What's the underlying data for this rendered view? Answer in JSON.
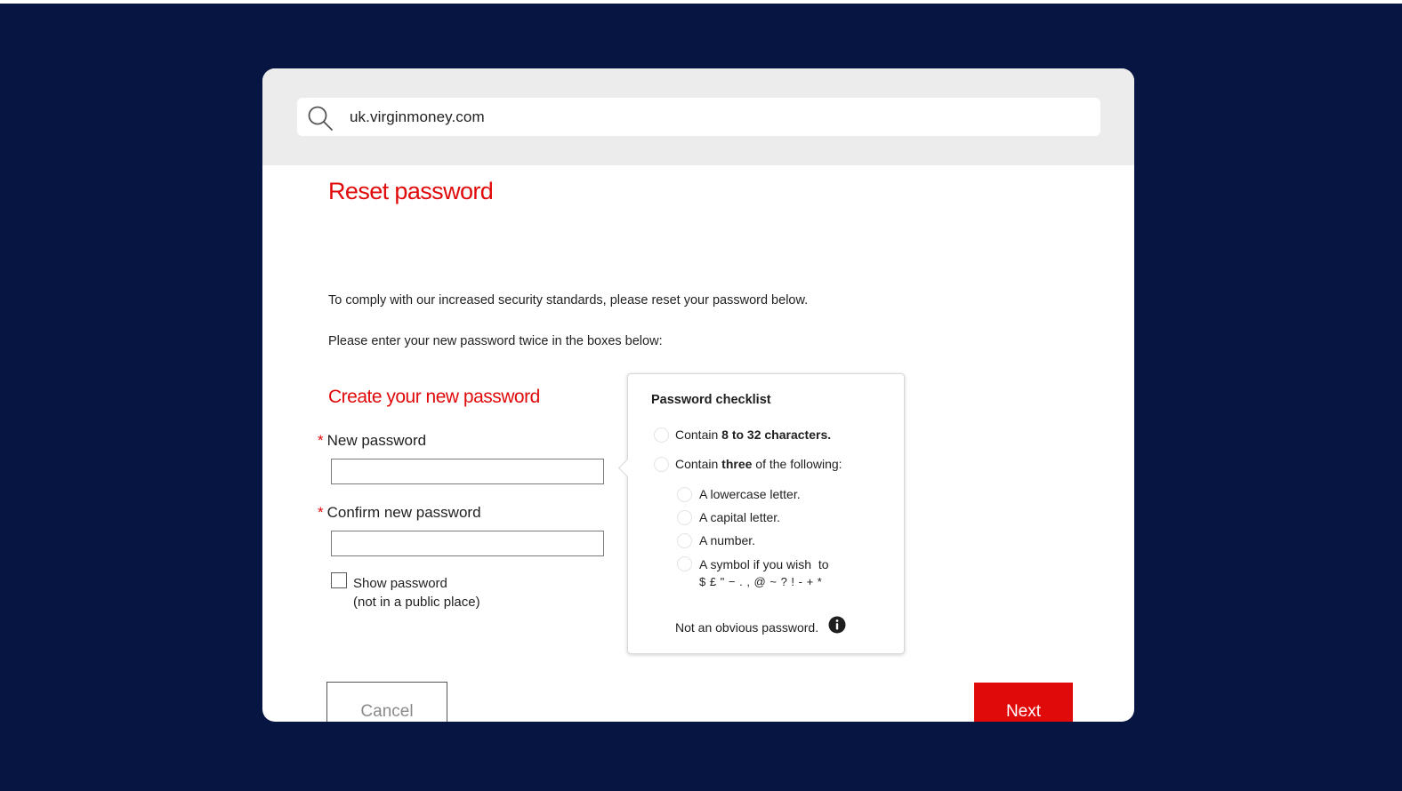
{
  "browser": {
    "url": "uk.virginmoney.com"
  },
  "page": {
    "title": "Reset password",
    "intro": "To comply with our increased security standards, please reset your password below.",
    "instruction": "Please enter your new password twice in the boxes below:",
    "section_title": "Create your new password"
  },
  "form": {
    "required_marker": "*",
    "new_password_label": "New password",
    "new_password_value": "",
    "confirm_password_label": "Confirm new password",
    "confirm_password_value": "",
    "show_password_label": "Show password",
    "show_password_note": "(not in a public place)",
    "show_password_checked": false
  },
  "checklist": {
    "title": "Password checklist",
    "item1_prefix": "Contain ",
    "item1_bold": "8 to 32 characters.",
    "item2_prefix": "Contain ",
    "item2_bold": "three",
    "item2_suffix": " of the following:",
    "sub_items": [
      "A lowercase letter.",
      "A capital letter.",
      "A number.",
      "A symbol if you wish  to"
    ],
    "symbols": "$ £ \" − . , @ ~ ? ! - + *",
    "obvious_note": "Not an obvious password."
  },
  "buttons": {
    "cancel": "Cancel",
    "next": "Next"
  },
  "colors": {
    "background": "#061541",
    "accent": "#e10a0a",
    "browser_bar": "#ececec"
  },
  "icons": {
    "address_bar": "search-icon",
    "obvious_note": "info-icon"
  }
}
